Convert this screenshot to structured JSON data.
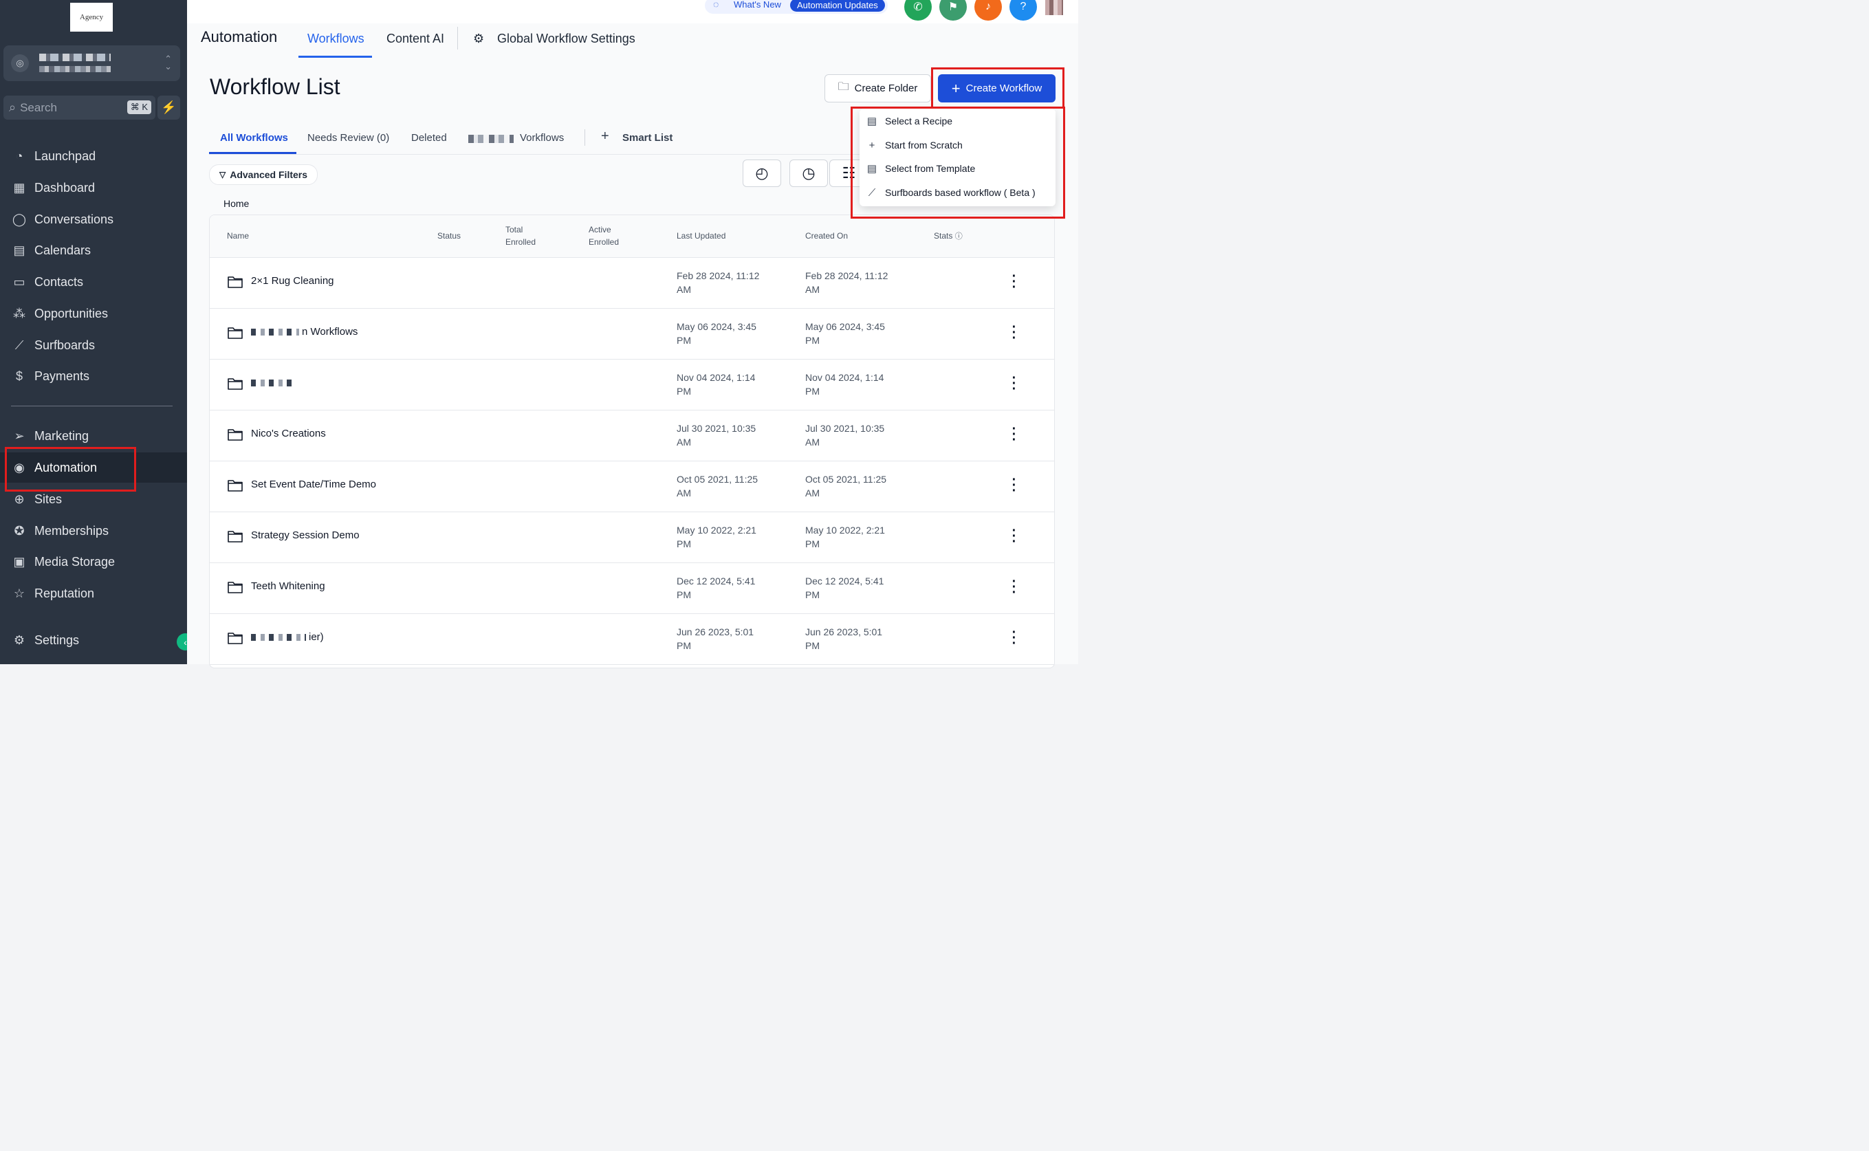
{
  "logo": {
    "text": "Agency"
  },
  "sidebar": {
    "search_placeholder": "Search",
    "search_shortcut": "⌘ K",
    "items_top": [
      {
        "label": "Launchpad",
        "icon": "launchpad-icon"
      },
      {
        "label": "Dashboard",
        "icon": "dashboard-icon"
      },
      {
        "label": "Conversations",
        "icon": "chat-icon"
      },
      {
        "label": "Calendars",
        "icon": "calendar-icon"
      },
      {
        "label": "Contacts",
        "icon": "contacts-icon"
      },
      {
        "label": "Opportunities",
        "icon": "opportunities-icon"
      },
      {
        "label": "Surfboards",
        "icon": "surfboard-icon"
      },
      {
        "label": "Payments",
        "icon": "payments-icon"
      }
    ],
    "items_bottom": [
      {
        "label": "Marketing",
        "icon": "send-icon"
      },
      {
        "label": "Automation",
        "icon": "automation-icon"
      },
      {
        "label": "Sites",
        "icon": "sites-icon"
      },
      {
        "label": "Memberships",
        "icon": "badge-icon"
      },
      {
        "label": "Media Storage",
        "icon": "image-icon"
      },
      {
        "label": "Reputation",
        "icon": "star-icon"
      }
    ],
    "settings": "Settings"
  },
  "topbar": {
    "whats_new": "What's New",
    "automation_updates": "Automation Updates",
    "colors": {
      "phone": "#22a55a",
      "announce": "#3c9d6e",
      "bell": "#f26a1b",
      "help": "#1d8cf0"
    }
  },
  "header": {
    "title": "Automation",
    "tabs": [
      "Workflows",
      "Content AI",
      "Global Workflow Settings"
    ]
  },
  "main": {
    "page_title": "Workflow List",
    "create_folder": "Create Folder",
    "create_workflow": "Create Workflow",
    "tabs": [
      "All Workflows",
      "Needs Review (0)",
      "Deleted",
      "Vorkflows",
      "Smart List"
    ],
    "advanced_filters": "Advanced Filters",
    "breadcrumb": "Home"
  },
  "dropdown": {
    "items": [
      "Select a Recipe",
      "Start from Scratch",
      "Select from Template",
      "Surfboards based workflow ( Beta )"
    ]
  },
  "table": {
    "headers": {
      "name": "Name",
      "status": "Status",
      "total_1": "Total",
      "total_2": "Enrolled",
      "active_1": "Active",
      "active_2": "Enrolled",
      "last_updated": "Last Updated",
      "created_on": "Created On",
      "stats": "Stats"
    },
    "rows": [
      {
        "name": "2×1 Rug Cleaning",
        "updated_1": "Feb 28 2024, 11:12",
        "updated_2": "AM",
        "created_1": "Feb 28 2024, 11:12",
        "created_2": "AM"
      },
      {
        "name": "n Workflows",
        "updated_1": "May 06 2024, 3:45",
        "updated_2": "PM",
        "created_1": "May 06 2024, 3:45",
        "created_2": "PM"
      },
      {
        "name": "",
        "updated_1": "Nov 04 2024, 1:14",
        "updated_2": "PM",
        "created_1": "Nov 04 2024, 1:14",
        "created_2": "PM"
      },
      {
        "name": "Nico's Creations",
        "updated_1": "Jul 30 2021, 10:35",
        "updated_2": "AM",
        "created_1": "Jul 30 2021, 10:35",
        "created_2": "AM"
      },
      {
        "name": "Set Event Date/Time Demo",
        "updated_1": "Oct 05 2021, 11:25",
        "updated_2": "AM",
        "created_1": "Oct 05 2021, 11:25",
        "created_2": "AM"
      },
      {
        "name": "Strategy Session Demo",
        "updated_1": "May 10 2022, 2:21",
        "updated_2": "PM",
        "created_1": "May 10 2022, 2:21",
        "created_2": "PM"
      },
      {
        "name": "Teeth Whitening",
        "updated_1": "Dec 12 2024, 5:41",
        "updated_2": "PM",
        "created_1": "Dec 12 2024, 5:41",
        "created_2": "PM"
      },
      {
        "name": "ier)",
        "updated_1": "Jun 26 2023, 5:01",
        "updated_2": "PM",
        "created_1": "Jun 26 2023, 5:01",
        "created_2": "PM"
      }
    ]
  },
  "colors": {
    "primary": "#1d4ed8",
    "sidebar": "#2b3441",
    "highlight": "#e11d1d"
  }
}
